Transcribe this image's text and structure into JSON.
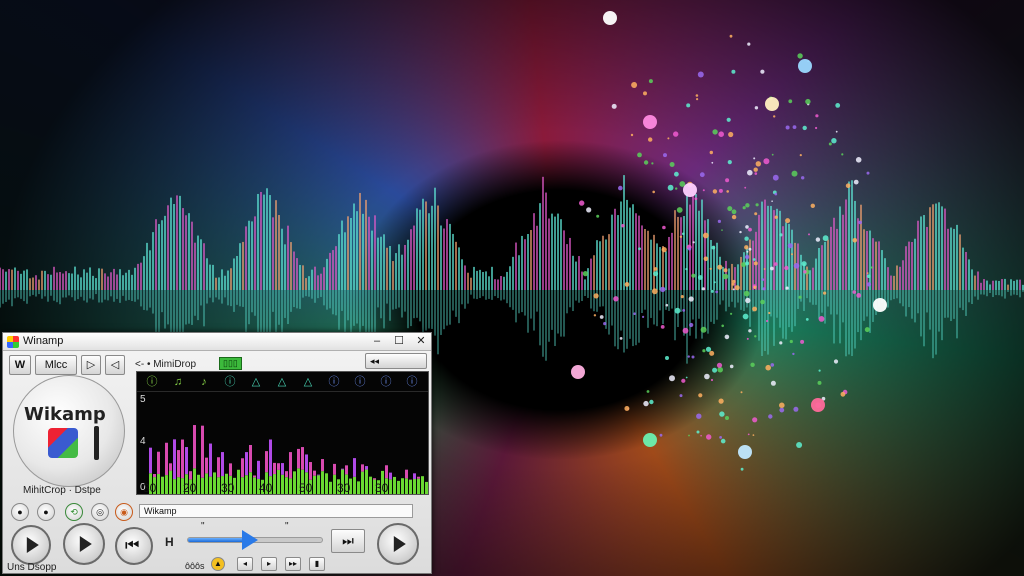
{
  "window": {
    "title": "Winamp",
    "minimize": "–",
    "maximize": "☐",
    "close": "✕"
  },
  "toolbar": {
    "w_label": "W",
    "mode_label": "Mlcc",
    "play_label": "▷",
    "speaker_label": "◁",
    "track_label": "<- • MimiDrop",
    "badge_label": "▯▯▯",
    "dropdown_label": "◂◂"
  },
  "logo": {
    "text": "Wikamp",
    "subtitle": "MihitCrop · Dstpe"
  },
  "equalizer": {
    "icons": [
      "ⓘ",
      "♫",
      "♪",
      "ⓘ",
      "△",
      "△",
      "△",
      "ⓘ",
      "ⓘ",
      "ⓘ",
      "ⓘ"
    ],
    "y_labels": [
      "5",
      "4",
      "0"
    ],
    "x_labels": [
      "30",
      "20",
      "30",
      "40",
      "50",
      "30",
      "30"
    ],
    "accent": "#6aa832"
  },
  "controls": {
    "playlist_text": "Wikamp",
    "time_left": "\"",
    "time_right": "\"",
    "stop_label": "H",
    "volume": 0.45,
    "status": "Uns Dsopp",
    "small_label": "ôôôs"
  },
  "colors": {
    "wave_cyan": "#5ee6d6",
    "wave_magenta": "#e05ac8",
    "wave_orange": "#f0a070",
    "accent_blue": "#2a7ae8"
  }
}
